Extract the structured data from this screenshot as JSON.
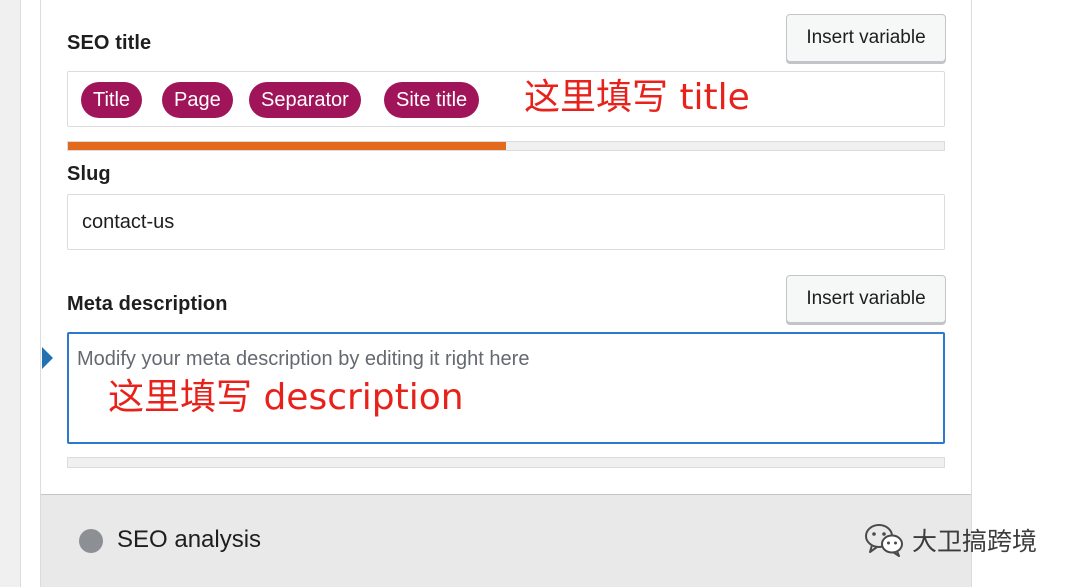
{
  "seo_title": {
    "label": "SEO title",
    "insert_variable_label": "Insert variable",
    "variables": [
      "Title",
      "Page",
      "Separator",
      "Site title"
    ],
    "progress_fraction": 0.5,
    "progress_color": "#e3691d"
  },
  "slug": {
    "label": "Slug",
    "value": "contact-us"
  },
  "meta_description": {
    "label": "Meta description",
    "insert_variable_label": "Insert variable",
    "placeholder": "Modify your meta description by editing it right here",
    "progress_fraction": 0
  },
  "annotations": {
    "title_hint": "这里填写 title",
    "description_hint": "这里填写 description"
  },
  "seo_analysis": {
    "label": "SEO analysis"
  },
  "watermark": {
    "text": "大卫搞跨境",
    "icon": "wechat-icon"
  },
  "colors": {
    "pill_bg": "#a0155a",
    "annotation": "#e8221b",
    "focus_border": "#2d79cf"
  }
}
